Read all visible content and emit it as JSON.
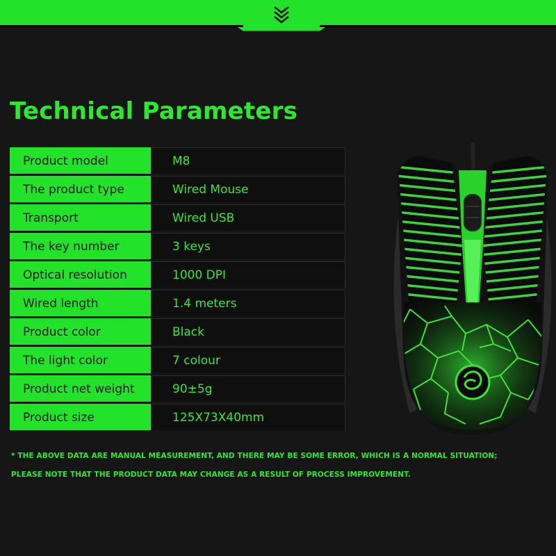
{
  "colors": {
    "accent": "#22e32a",
    "background": "#161616",
    "value_text": "#38e838"
  },
  "title": "Technical Parameters",
  "specs": [
    {
      "label": "Product model",
      "value": "M8"
    },
    {
      "label": "The product type",
      "value": "Wired Mouse"
    },
    {
      "label": "Transport",
      "value": "Wired USB"
    },
    {
      "label": "The key number",
      "value": "3 keys"
    },
    {
      "label": "Optical resolution",
      "value": "1000 DPI"
    },
    {
      "label": "Wired length",
      "value": "1.4 meters"
    },
    {
      "label": "Product color",
      "value": "Black"
    },
    {
      "label": "The light color",
      "value": "7 colour"
    },
    {
      "label": "Product net weight",
      "value": "90±5g"
    },
    {
      "label": "Product size",
      "value": "125X73X40mm"
    }
  ],
  "notes": [
    "* THE ABOVE DATA ARE MANUAL MEASUREMENT, AND THERE MAY BE SOME ERROR, WHICH IS A NORMAL SITUATION;",
    "PLEASE NOTE THAT THE PRODUCT DATA MAY CHANGE AS A RESULT OF PROCESS IMPROVEMENT."
  ],
  "icons": {
    "header": "chevron-down-icon",
    "product": "mouse-image"
  }
}
